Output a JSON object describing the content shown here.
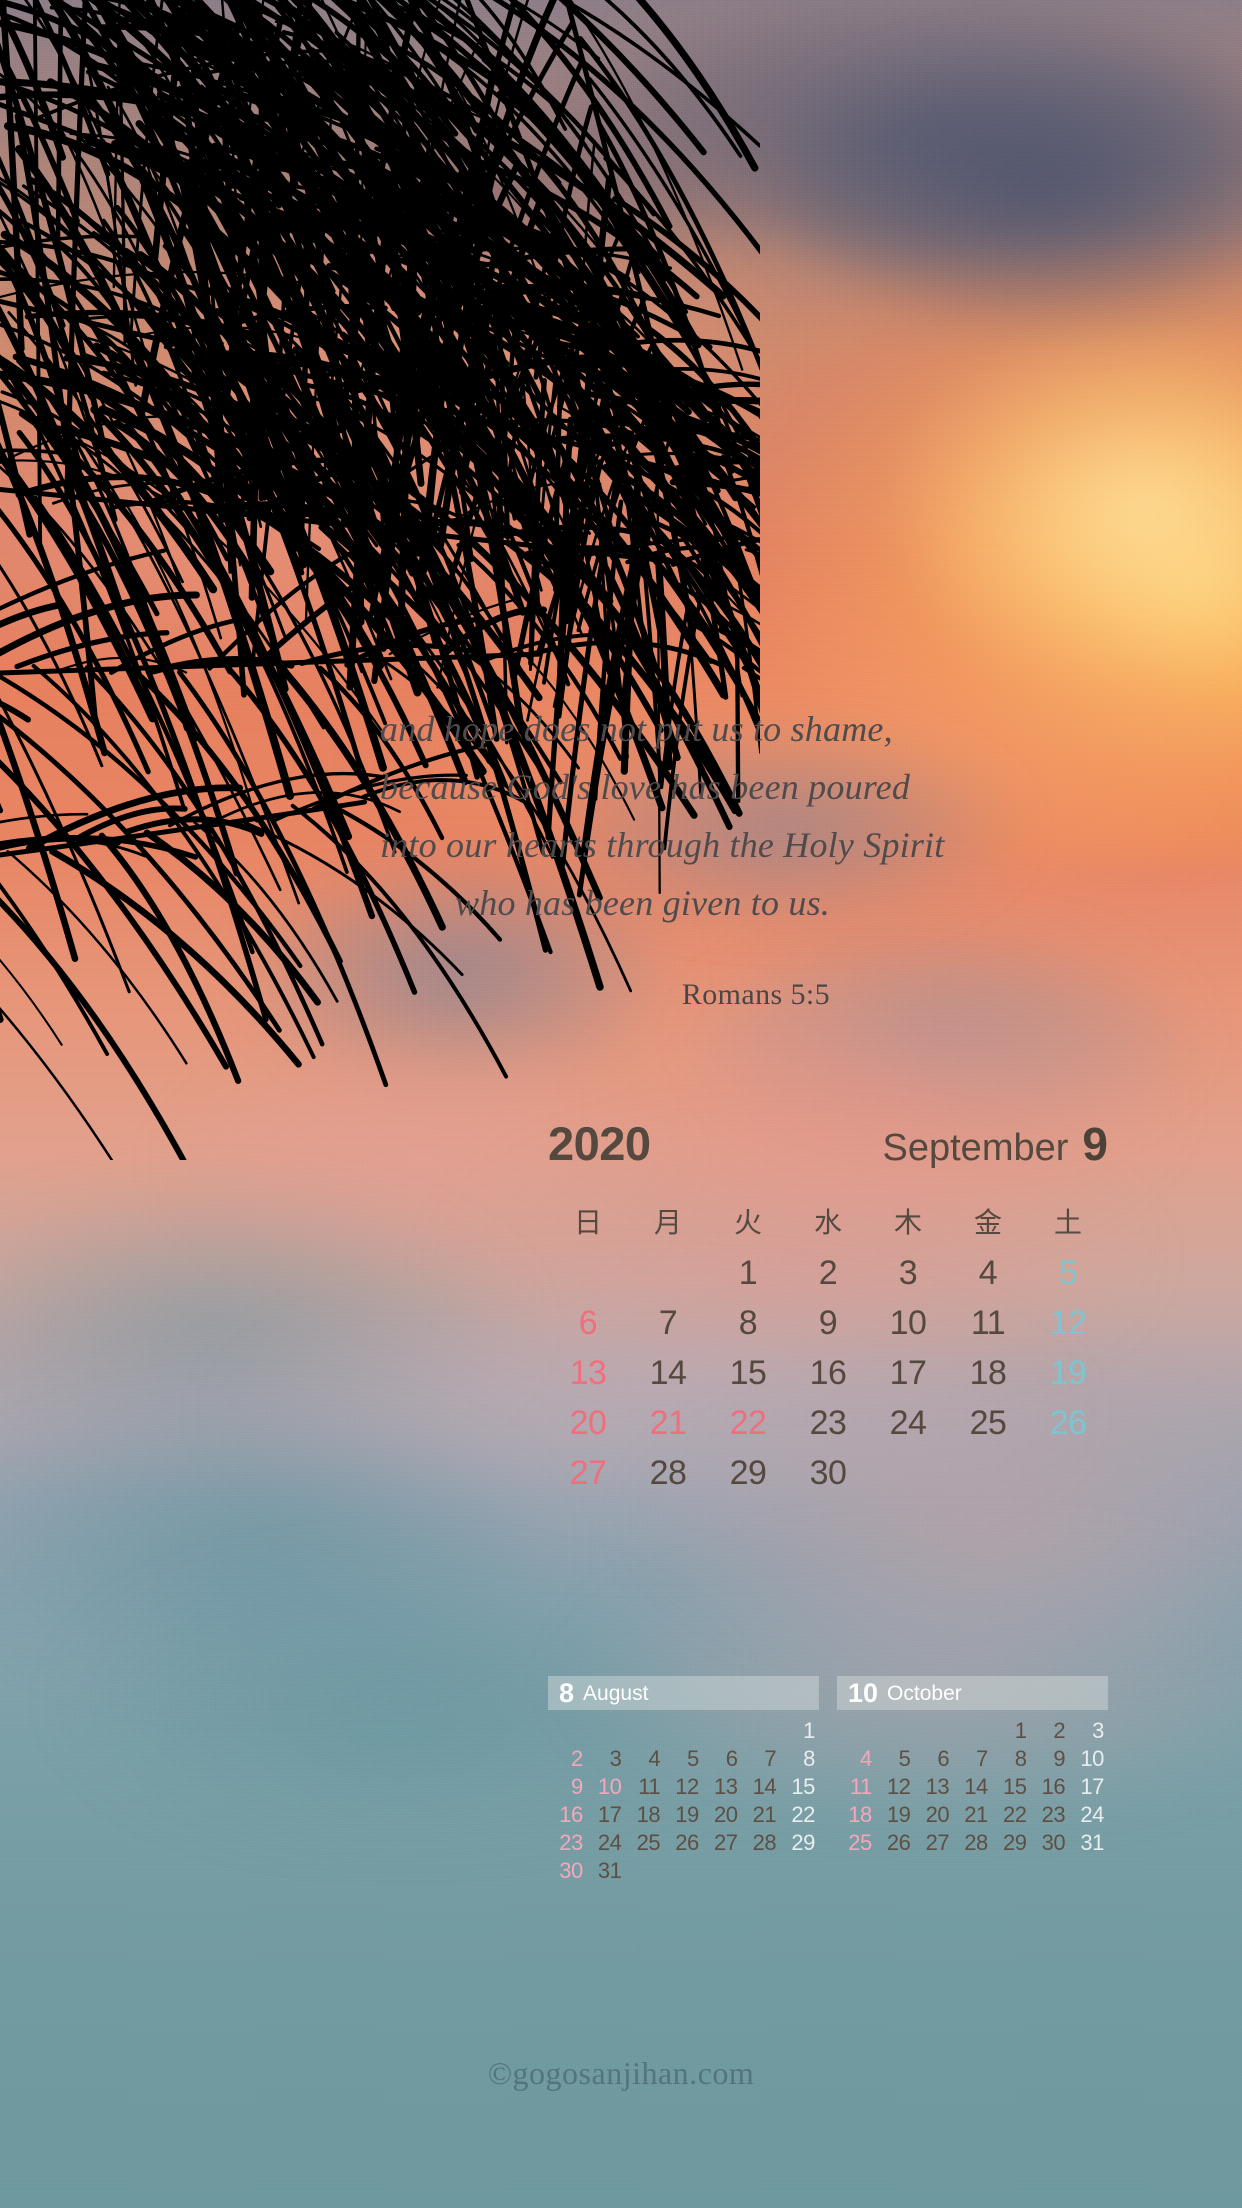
{
  "colors": {
    "sunday": "#ef6f7d",
    "saturday": "#7fc5cf",
    "weekday": "#55493f",
    "mini_sunday": "#f3a8bb",
    "mini_saturday": "#e8eef0",
    "mini_weekday": "#5d4f43",
    "quote_text": "#4f4a4c",
    "header_text": "#54483f",
    "footer_text": "#4b6b72"
  },
  "quote": {
    "lines": [
      "and hope does not put us to shame,",
      "because God's love has been poured",
      "into our hearts through the Holy Spirit",
      "who has been given to us."
    ],
    "reference": "Romans 5:5"
  },
  "calendar": {
    "year": "2020",
    "month_name": "September",
    "month_number": "9",
    "weekday_headers": [
      "日",
      "月",
      "火",
      "水",
      "木",
      "金",
      "土"
    ],
    "weeks": [
      [
        "",
        "",
        "1",
        "2",
        "3",
        "4",
        "5"
      ],
      [
        "6",
        "7",
        "8",
        "9",
        "10",
        "11",
        "12"
      ],
      [
        "13",
        "14",
        "15",
        "16",
        "17",
        "18",
        "19"
      ],
      [
        "20",
        "21",
        "22",
        "23",
        "24",
        "25",
        "26"
      ],
      [
        "27",
        "28",
        "29",
        "30",
        "",
        "",
        ""
      ]
    ],
    "holidays": [
      "21",
      "22"
    ]
  },
  "mini_calendars": [
    {
      "number": "8",
      "name": "August",
      "weeks": [
        [
          "",
          "",
          "",
          "",
          "",
          "",
          "1"
        ],
        [
          "2",
          "3",
          "4",
          "5",
          "6",
          "7",
          "8"
        ],
        [
          "9",
          "10",
          "11",
          "12",
          "13",
          "14",
          "15"
        ],
        [
          "16",
          "17",
          "18",
          "19",
          "20",
          "21",
          "22"
        ],
        [
          "23",
          "24",
          "25",
          "26",
          "27",
          "28",
          "29"
        ],
        [
          "30",
          "31",
          "",
          "",
          "",
          "",
          ""
        ]
      ],
      "holidays": [
        "10"
      ]
    },
    {
      "number": "10",
      "name": "October",
      "weeks": [
        [
          "",
          "",
          "",
          "",
          "1",
          "2",
          "3"
        ],
        [
          "4",
          "5",
          "6",
          "7",
          "8",
          "9",
          "10"
        ],
        [
          "11",
          "12",
          "13",
          "14",
          "15",
          "16",
          "17"
        ],
        [
          "18",
          "19",
          "20",
          "21",
          "22",
          "23",
          "24"
        ],
        [
          "25",
          "26",
          "27",
          "28",
          "29",
          "30",
          "31"
        ]
      ],
      "holidays": []
    }
  ],
  "footer": {
    "watermark": "©gogosanjihan.com"
  }
}
